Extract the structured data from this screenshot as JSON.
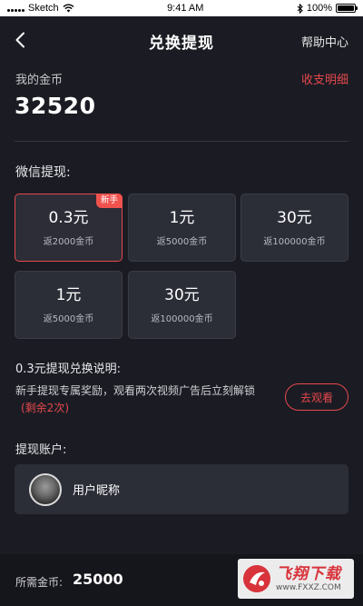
{
  "status_bar": {
    "carrier": "Sketch",
    "time": "9:41 AM",
    "battery": "100%"
  },
  "nav": {
    "title": "兑换提现",
    "help": "帮助中心"
  },
  "coins": {
    "label": "我的金币",
    "detail_link": "收支明细",
    "value": "32520"
  },
  "wechat": {
    "title": "微信提现:",
    "options": [
      {
        "price": "0.3元",
        "sub": "返2000金币",
        "badge": "新手",
        "selected": true
      },
      {
        "price": "1元",
        "sub": "返5000金币",
        "badge": "",
        "selected": false
      },
      {
        "price": "30元",
        "sub": "返100000金币",
        "badge": "",
        "selected": false
      },
      {
        "price": "1元",
        "sub": "返5000金币",
        "badge": "",
        "selected": false
      },
      {
        "price": "30元",
        "sub": "返100000金币",
        "badge": "",
        "selected": false
      }
    ]
  },
  "explain": {
    "title": "0.3元提现兑换说明:",
    "text": "新手提现专属奖励，观看两次视频广告后立刻解锁",
    "remain": "(剩余2次)",
    "button": "去观看"
  },
  "account": {
    "title": "提现账户:",
    "nickname": "用户昵称"
  },
  "footer": {
    "need_label": "所需金币:",
    "need_value": "25000"
  },
  "watermark": {
    "title": "飞翔下载",
    "url": "www.FXXZ.COM"
  }
}
